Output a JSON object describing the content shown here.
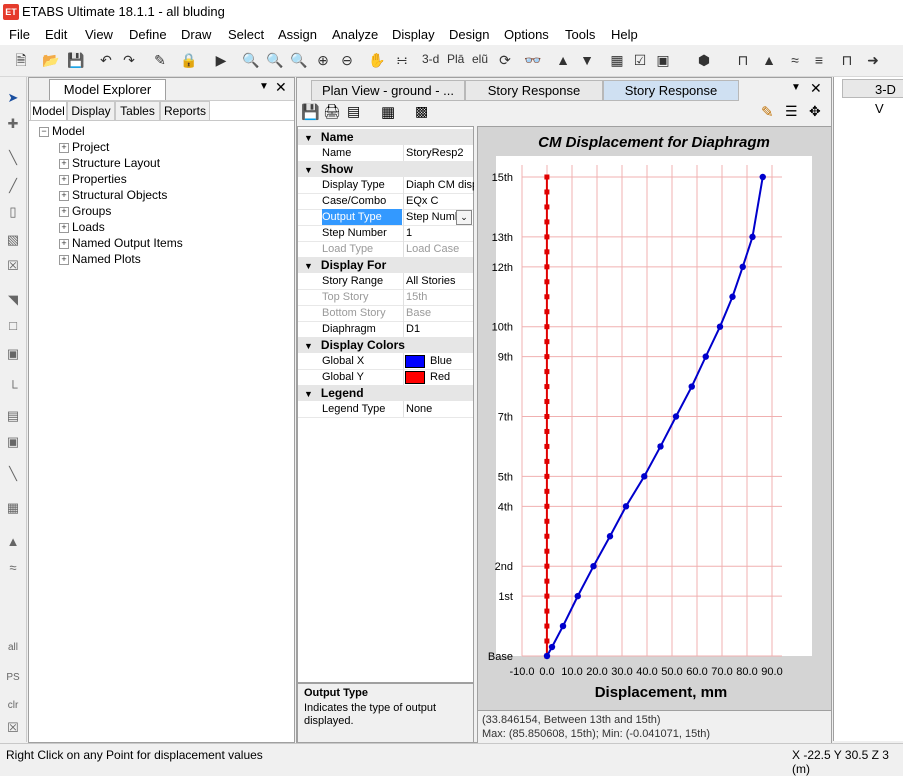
{
  "window": {
    "title": "ETABS Ultimate 18.1.1 - all bluding",
    "logo": "ET"
  },
  "menu": [
    "File",
    "Edit",
    "View",
    "Define",
    "Draw",
    "Select",
    "Assign",
    "Analyze",
    "Display",
    "Design",
    "Options",
    "Tools",
    "Help"
  ],
  "toolbar": {
    "three_d_label": "3-d",
    "pln_label": "Plā",
    "elv_label": "elũ"
  },
  "left_tools": {
    "all_label": "all",
    "ps_label": "PS",
    "clr_label": "clr"
  },
  "explorer": {
    "title": "Model Explorer",
    "tabs": [
      "Model",
      "Display",
      "Tables",
      "Reports"
    ],
    "root": "Model",
    "items": [
      "Project",
      "Structure Layout",
      "Properties",
      "Structural Objects",
      "Groups",
      "Loads",
      "Named Output Items",
      "Named Plots"
    ]
  },
  "doc_tabs": [
    "Plan View - ground - ...",
    "Story Response",
    "Story Response"
  ],
  "right_tab": "3-D V",
  "properties": {
    "name_cat": "Name",
    "name_label": "Name",
    "name_value": "StoryResp2",
    "show_cat": "Show",
    "display_type_label": "Display Type",
    "display_type_value": "Diaph CM disp",
    "case_label": "Case/Combo",
    "case_value": "EQx C",
    "output_type_label": "Output Type",
    "output_type_value": "Step Numb",
    "step_number_label": "Step Number",
    "step_number_value": "1",
    "load_type_label": "Load Type",
    "load_type_value": "Load Case",
    "display_for_cat": "Display For",
    "story_range_label": "Story Range",
    "story_range_value": "All Stories",
    "top_story_label": "Top Story",
    "top_story_value": "15th",
    "bottom_story_label": "Bottom Story",
    "bottom_story_value": "Base",
    "diaphragm_label": "Diaphragm",
    "diaphragm_value": "D1",
    "colors_cat": "Display Colors",
    "global_x_label": "Global X",
    "global_x_value": "Blue",
    "global_x_color": "#0000ff",
    "global_y_label": "Global Y",
    "global_y_value": "Red",
    "global_y_color": "#ff0000",
    "legend_cat": "Legend",
    "legend_type_label": "Legend Type",
    "legend_type_value": "None"
  },
  "description": {
    "title": "Output Type",
    "text": "Indicates the type of output displayed."
  },
  "chart_data": {
    "type": "line",
    "title": "CM Displacement for Diaphragm",
    "xlabel": "Displacement, mm",
    "xlim": [
      -10,
      90
    ],
    "x_ticks": [
      "-10.0",
      "0.0",
      "10.0",
      "20.0",
      "30.0",
      "40.0",
      "50.0",
      "60.0",
      "70.0",
      "80.0",
      "90.0"
    ],
    "x_tick_values": [
      -10,
      0,
      10,
      20,
      30,
      40,
      50,
      60,
      70,
      80,
      90
    ],
    "y_tick_labels": [
      "Base",
      "1st",
      "2nd",
      "4th",
      "5th",
      "7th",
      "9th",
      "10th",
      "12th",
      "13th",
      "15th"
    ],
    "y_tick_levels": [
      0,
      2,
      3,
      5,
      6,
      8,
      10,
      11,
      13,
      14,
      16
    ],
    "levels": [
      0,
      0.3,
      1,
      2,
      3,
      4,
      5,
      6,
      7,
      8,
      9,
      10,
      11,
      12,
      13,
      14,
      15,
      16
    ],
    "series": [
      {
        "color": "#0000cc",
        "values": [
          0,
          2,
          6.4,
          12.3,
          18.6,
          25.2,
          31.6,
          38.9,
          45.4,
          51.6,
          57.9,
          63.5,
          69.2,
          74.2,
          78.3,
          82.2,
          86.3
        ]
      },
      {
        "color": "#e00000",
        "values": [
          -0.04,
          -0.04,
          -0.04,
          -0.04,
          -0.04,
          -0.04,
          -0.04,
          -0.04,
          -0.04,
          -0.04,
          -0.04,
          -0.04,
          -0.04,
          -0.04,
          -0.04,
          -0.04,
          -0.04,
          -0.04,
          -0.04,
          -0.04,
          -0.04,
          -0.04,
          -0.04,
          -0.04,
          -0.04,
          -0.04,
          -0.04,
          -0.04,
          -0.04,
          -0.04,
          -0.04,
          -0.04,
          -0.04
        ]
      }
    ],
    "grid": true,
    "legend": "none"
  },
  "chart_status": {
    "line1": "(33.846154, Between 13th and 15th)",
    "line2": "Max: (85.850608, 15th);  Min: (-0.041071, 15th)"
  },
  "status": {
    "left": "Right Click on any Point for displacement values",
    "right": "X -22.5  Y 30.5  Z 3 (m)"
  }
}
